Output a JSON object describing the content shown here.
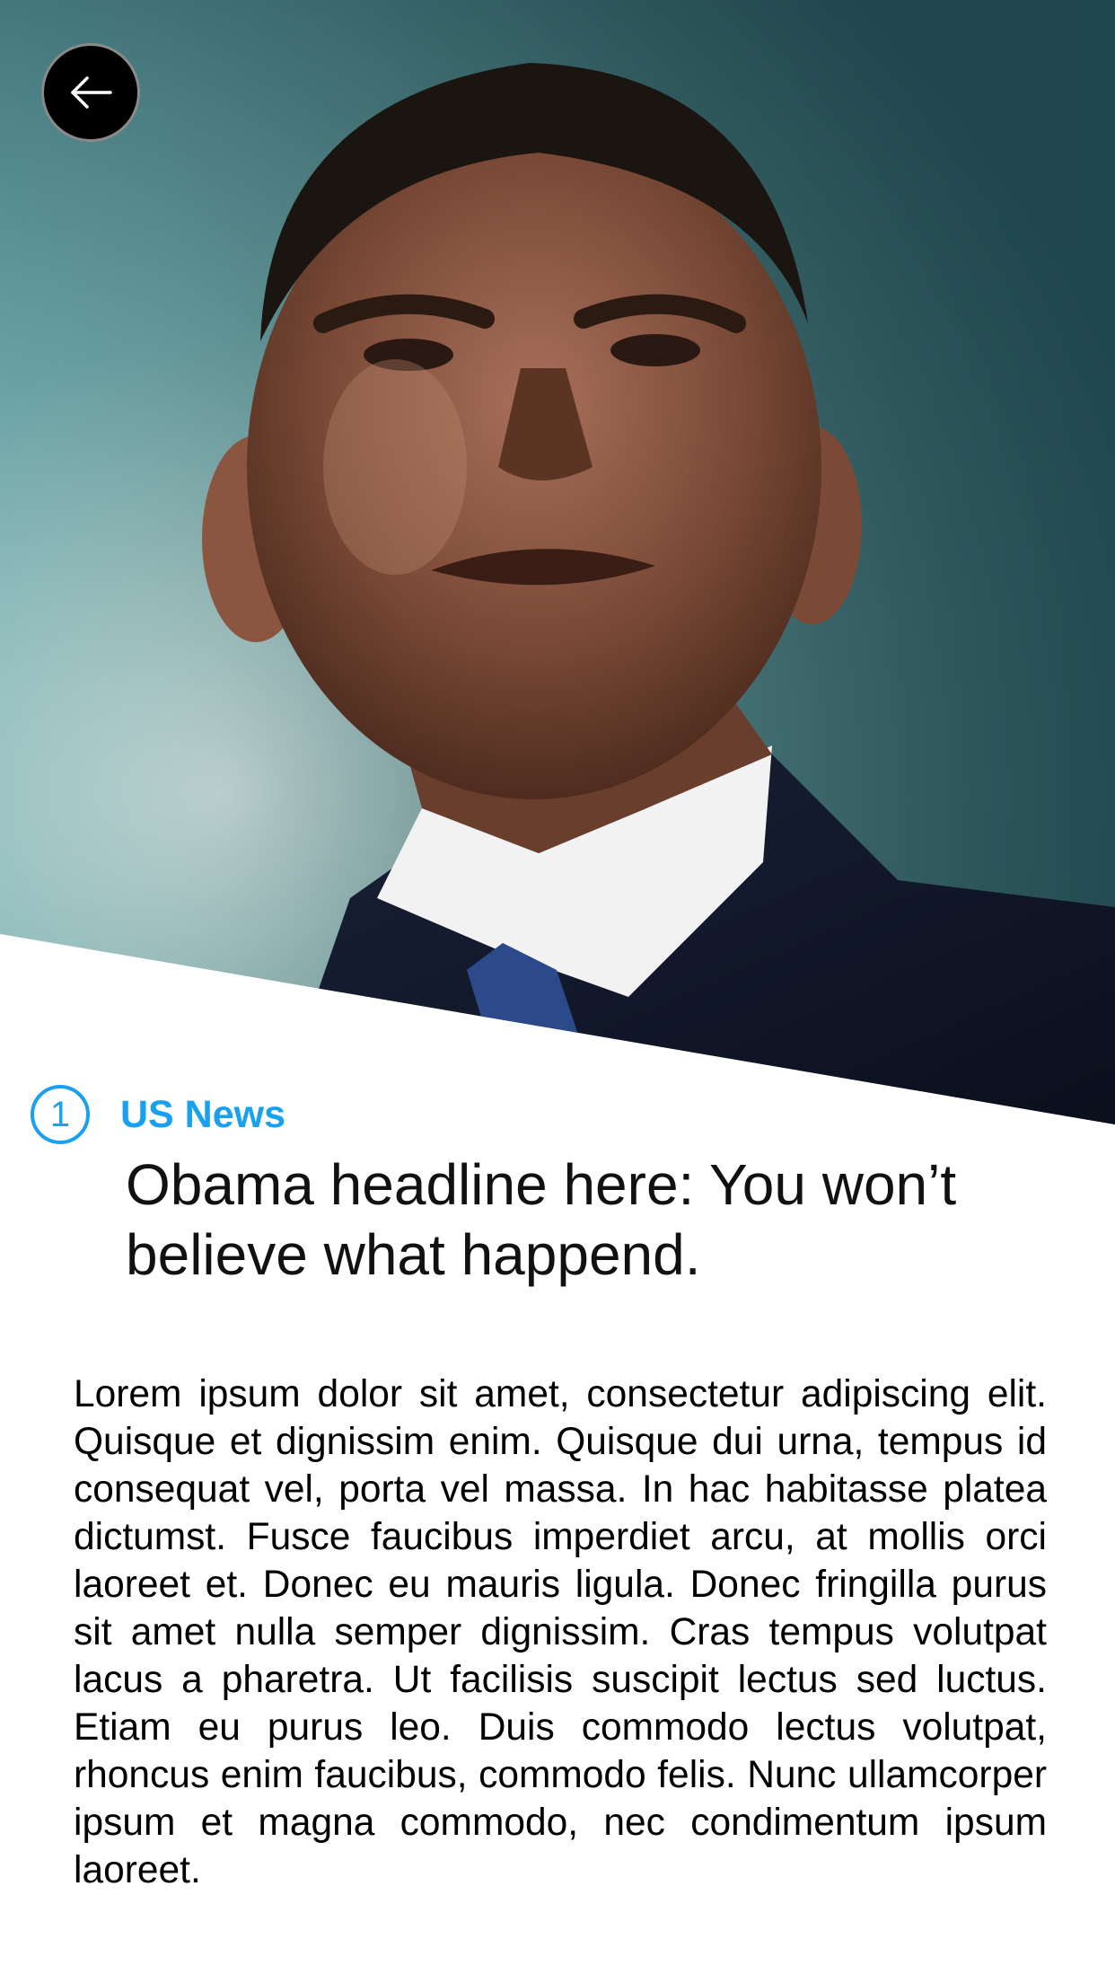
{
  "article": {
    "rank": "1",
    "category": "US News",
    "headline": "Obama headline here: You won’t believe what happend.",
    "body": "Lorem ipsum dolor sit amet, consectetur adipiscing elit. Quisque et dignissim enim. Quisque dui urna, tempus id consequat vel, porta vel massa. In hac habitasse platea dictumst. Fusce faucibus imperdiet arcu, at mollis orci laoreet et. Donec eu mauris ligula. Donec fringilla purus sit amet nulla semper dignissim. Cras tempus volutpat lacus a pharetra. Ut facilisis suscipit lectus sed luctus. Etiam eu purus leo. Duis commodo lectus volutpat, rhoncus enim faucibus, commodo felis. Nunc ullamcorper ipsum et magna commodo, nec condimentum ipsum laoreet."
  },
  "icons": {
    "back": "arrow-left-icon",
    "hero": "portrait-photo"
  },
  "colors": {
    "accent": "#1aa0f0",
    "text": "#111111",
    "back_button_bg": "#000000",
    "background": "#ffffff"
  }
}
